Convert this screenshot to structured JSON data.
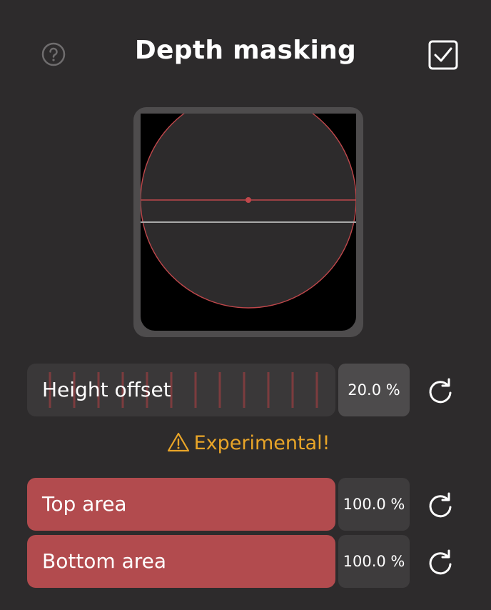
{
  "header": {
    "title": "Depth masking",
    "help_icon": "question-circle-icon",
    "enabled": true
  },
  "preview": {
    "background": "#000000",
    "circle_color": "#c0474b",
    "center_line_color": "#c0474b",
    "offset_line_color": "#a9a9a9"
  },
  "sliders": {
    "height_offset": {
      "label": "Height offset",
      "value": "20.0 %",
      "fraction": 0.2
    },
    "top_area": {
      "label": "Top area",
      "value": "100.0 %",
      "fraction": 1.0
    },
    "bottom_area": {
      "label": "Bottom area",
      "value": "100.0 %",
      "fraction": 1.0
    }
  },
  "warning": {
    "icon": "warning-triangle-icon",
    "text": "Experimental!",
    "color": "#e9a528"
  },
  "colors": {
    "accent": "#b24b4e",
    "panel": "#2d2b2c",
    "track": "#3a3839"
  }
}
